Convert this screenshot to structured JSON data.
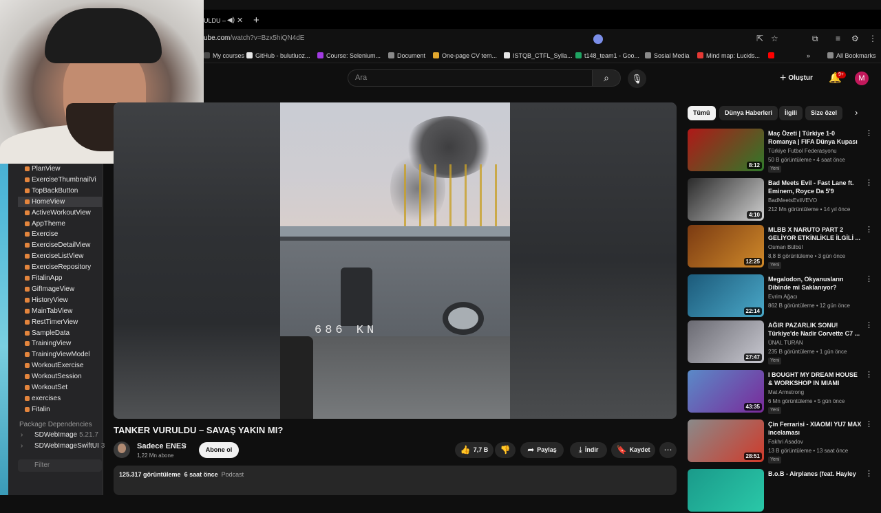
{
  "xcode": {
    "files": [
      "PlanView",
      "ExerciseThumbnailVi",
      "TopBackButton",
      "HomeView",
      "ActiveWorkoutView",
      "AppTheme",
      "Exercise",
      "ExerciseDetailView",
      "ExerciseListView",
      "ExerciseRepository",
      "FitalinApp",
      "GifImageView",
      "HistoryView",
      "MainTabView",
      "RestTimerView",
      "SampleData",
      "TrainingView",
      "TrainingViewModel",
      "WorkoutExercise",
      "WorkoutSession",
      "WorkoutSet",
      "exercises",
      "Fitalin"
    ],
    "selected_file": "HomeView",
    "package_header": "Package Dependencies",
    "packages": [
      {
        "name": "SDWebImage",
        "version": "5.21.7"
      },
      {
        "name": "SDWebImageSwiftUI",
        "version": "3"
      }
    ],
    "filter_placeholder": "Filter"
  },
  "browser": {
    "tab_title": "ULDU –",
    "url_host": "ube.com",
    "url_path": "/watch?v=Bzx5hiQN4dE",
    "bookmarks": [
      {
        "label": "My courses",
        "color": "#4a4a4a"
      },
      {
        "label": "GitHub - bulutluoz...",
        "color": "#e6e6e6"
      },
      {
        "label": "Course: Selenium...",
        "color": "#a23be2"
      },
      {
        "label": "Document",
        "color": "#8a8a8a"
      },
      {
        "label": "One-page CV tem...",
        "color": "#e2a72e"
      },
      {
        "label": "ISTQB_CTFL_Sylla...",
        "color": "#e6e6e6"
      },
      {
        "label": "t148_team1 - Goo...",
        "color": "#1fa463"
      },
      {
        "label": "Sosial Media",
        "color": "#8a8a8a"
      },
      {
        "label": "Mind map: Lucids...",
        "color": "#e53935"
      },
      {
        "label": "",
        "color": "#ff0000"
      }
    ],
    "all_bookmarks": "All Bookmarks"
  },
  "youtube": {
    "search_placeholder": "Ara",
    "create_label": "Oluştur",
    "notifications_badge": "9+",
    "avatar_letter": "M"
  },
  "video": {
    "title": "TANKER VURULDU – SAVAŞ YAKIN MI?",
    "frame_text": "686 KN",
    "channel": "Sadece ENES",
    "subscribers": "1,22 Mn abone",
    "subscribe_label": "Abone ol",
    "likes": "7,7 B",
    "share_label": "Paylaş",
    "download_label": "İndir",
    "save_label": "Kaydet",
    "views": "125.317 görüntüleme",
    "time": "6 saat önce",
    "tag": "Podcast"
  },
  "chips": [
    "Tümü",
    "Dünya Haberleri",
    "İlgili",
    "Size özel"
  ],
  "recommendations": [
    {
      "title": "Maç Özeti | Türkiye 1-0 Romanya | FIFA Dünya Kupası ...",
      "channel": "Türkiye Futbol Federasyonu",
      "meta": "50 B görüntüleme • 4 saat önce",
      "badge": "Yeni",
      "duration": "8:12",
      "colors": [
        "#b01818",
        "#2f7a2a"
      ]
    },
    {
      "title": "Bad Meets Evil - Fast Lane ft. Eminem, Royce Da 5'9",
      "channel": "BadMeetsEvilVEVO",
      "meta": "212 Mn görüntüleme • 14 yıl önce",
      "badge": "",
      "duration": "4:10",
      "colors": [
        "#2a2a2a",
        "#cfcfcf"
      ]
    },
    {
      "title": "MLBB X NARUTO PART 2 GELİYOR ETKİNLİKLE İLGİLİ ...",
      "channel": "Osman Bülbül",
      "meta": "8,8 B görüntüleme • 3 gün önce",
      "badge": "Yeni",
      "duration": "12:25",
      "colors": [
        "#7a3a12",
        "#d08a2a"
      ]
    },
    {
      "title": "Megalodon, Okyanusların Dibinde mi Saklanıyor?",
      "channel": "Evrim Ağacı",
      "meta": "862 B görüntüleme • 12 gün önce",
      "badge": "",
      "duration": "22:14",
      "colors": [
        "#1c5a7a",
        "#4aa8c8"
      ]
    },
    {
      "title": "AĞIR PAZARLIK SONU! Türkiye'de Nadir Corvette C7 ...",
      "channel": "ÜNAL TURAN",
      "meta": "235 B görüntüleme • 1 gün önce",
      "badge": "Yeni",
      "duration": "27:47",
      "colors": [
        "#6a6a72",
        "#c8c8d0"
      ]
    },
    {
      "title": "I BOUGHT MY DREAM HOUSE & WORKSHOP IN MIAMI",
      "channel": "Mat Armstrong",
      "meta": "6 Mn görüntüleme • 5 gün önce",
      "badge": "Yeni",
      "duration": "43:35",
      "colors": [
        "#5a8ac8",
        "#7a2a9a"
      ]
    },
    {
      "title": "Çin Ferrarisi - XIAOMI YU7 MAX incelaması",
      "channel": "Fakhri Asadov",
      "meta": "13 B görüntüleme • 13 saat önce",
      "badge": "Yeni",
      "duration": "28:51",
      "colors": [
        "#8a8a8a",
        "#d03a2a"
      ]
    },
    {
      "title": "B.o.B - Airplanes (feat. Hayley",
      "channel": "",
      "meta": "",
      "badge": "",
      "duration": "",
      "colors": [
        "#1a9a8a",
        "#2ac8a8"
      ]
    }
  ]
}
